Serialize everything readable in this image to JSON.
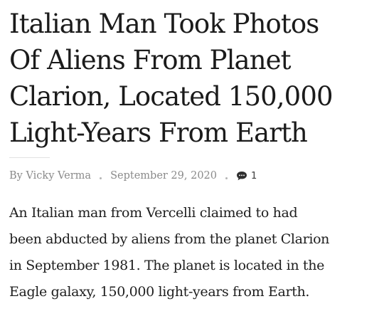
{
  "article": {
    "title_lines": [
      "Italian Man Took Photos",
      "Of Aliens From Planet",
      "Clarion, Located 150,000",
      "Light-Years From Earth"
    ],
    "author": "By Vicky Verma",
    "date": "September 29, 2020",
    "comment_count": "1",
    "excerpt_lines": [
      "An Italian man from Vercelli claimed to had",
      "been abducted by aliens from the planet Clarion",
      "in September 1981. The planet is located in the",
      "Eagle galaxy, 150,000 light-years from Earth."
    ]
  },
  "colors": {
    "title": "#1b1b1b",
    "meta": "#8a8a8a",
    "body": "#1e1e1e"
  },
  "icons": {
    "comment": "speech-bubble-icon"
  }
}
